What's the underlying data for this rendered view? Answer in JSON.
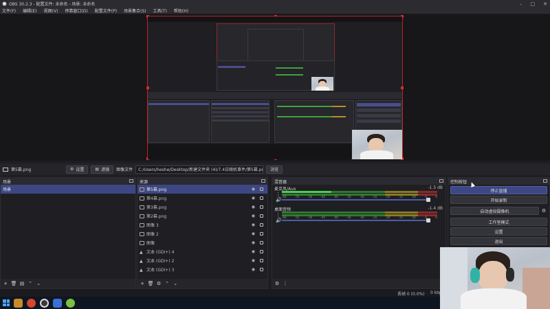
{
  "window": {
    "title": "OBS 30.2.3 - 配置文件: 未命名 - 场景: 未命名",
    "controls": [
      "–",
      "□",
      "✕"
    ]
  },
  "menu": [
    "文件(F)",
    "编辑(E)",
    "视图(V)",
    "停靠窗口(D)",
    "配置文件(P)",
    "场景集合(S)",
    "工具(T)",
    "帮助(H)"
  ],
  "source_toolbar": {
    "source_name": "第5幕.png",
    "properties_label": "设置",
    "filters_label": "滤镜",
    "image_file_label": "图像文件",
    "image_path": "C:/Users/heshe/Desktop/新建文件夹 (4)/7.4日随机事件/第5幕.png",
    "browse_label": "浏览"
  },
  "scenes": {
    "title": "场景",
    "items": [
      "场景"
    ]
  },
  "sources": {
    "title": "来源",
    "items": [
      {
        "label": "第5幕.png",
        "type": "image",
        "selected": true
      },
      {
        "label": "第4幕.png",
        "type": "image"
      },
      {
        "label": "第3幕.png",
        "type": "image"
      },
      {
        "label": "第2幕.png",
        "type": "image"
      },
      {
        "label": "图像 3",
        "type": "image"
      },
      {
        "label": "图像 2",
        "type": "image"
      },
      {
        "label": "图像",
        "type": "image"
      },
      {
        "label": "文本 (GDI+) 4",
        "type": "text"
      },
      {
        "label": "文本 (GDI+) 2",
        "type": "text"
      },
      {
        "label": "文本 (GDI+) 3",
        "type": "text"
      }
    ]
  },
  "mixer": {
    "title": "混音器",
    "channels": [
      {
        "name": "麦克风/Aux",
        "db": "-1.5 dB"
      },
      {
        "name": "桌面音频",
        "db": "-1.4 dB"
      }
    ],
    "ticks": [
      "-60",
      "-55",
      "-50",
      "-45",
      "-40",
      "-35",
      "-30",
      "-25",
      "-20",
      "-15",
      "-10",
      "-5",
      "0"
    ]
  },
  "controls": {
    "title": "控制按钮",
    "buttons": [
      "停止直播",
      "开始录制",
      "启动虚拟摄像机",
      "工作室模式",
      "设置",
      "退出"
    ]
  },
  "status": {
    "dropped": "丢帧 0 (0.0%)",
    "bitrate": "0 kbps"
  },
  "colors": {
    "accent": "#3d4783",
    "selection_border": "#c02424",
    "meter_green": "#3ea33e"
  }
}
